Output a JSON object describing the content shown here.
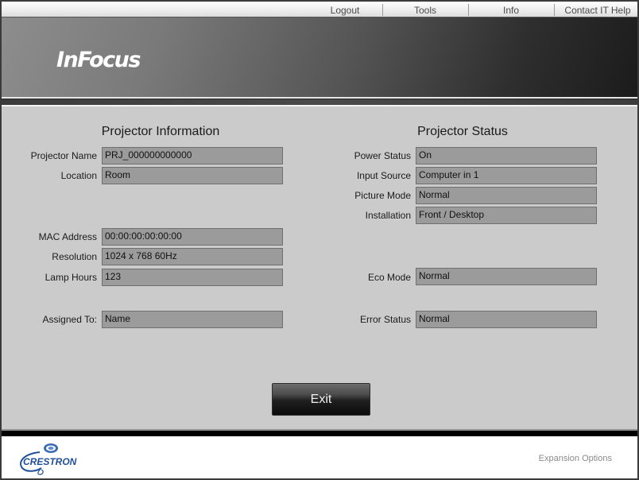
{
  "topnav": {
    "items": [
      {
        "label": "Logout"
      },
      {
        "label": "Tools"
      },
      {
        "label": "Info"
      },
      {
        "label": "Contact IT Help"
      }
    ]
  },
  "banner": {
    "logo_text": "InFocus"
  },
  "projector_information": {
    "title": "Projector Information",
    "fields": [
      {
        "label": "Projector Name",
        "value": "PRJ_000000000000"
      },
      {
        "label": "Location",
        "value": "Room"
      },
      {
        "label": "MAC Address",
        "value": "00:00:00:00:00:00"
      },
      {
        "label": "Resolution",
        "value": "1024 x 768 60Hz"
      },
      {
        "label": "Lamp Hours",
        "value": "123"
      },
      {
        "label": "Assigned To:",
        "value": "Name"
      }
    ]
  },
  "projector_status": {
    "title": "Projector Status",
    "fields": [
      {
        "label": "Power Status",
        "value": "On"
      },
      {
        "label": "Input Source",
        "value": "Computer in 1"
      },
      {
        "label": "Picture Mode",
        "value": "Normal"
      },
      {
        "label": "Installation",
        "value": "Front / Desktop"
      },
      {
        "label": "Eco Mode",
        "value": "Normal"
      },
      {
        "label": "Error Status",
        "value": "Normal"
      }
    ]
  },
  "actions": {
    "exit_label": "Exit"
  },
  "footer": {
    "brand_text": "CRESTRON",
    "expansion_label": "Expansion Options"
  },
  "colors": {
    "field_bg": "#9b9b9b",
    "panel_bg": "#cbcbcb",
    "crestron_blue": "#1f4f9a"
  }
}
